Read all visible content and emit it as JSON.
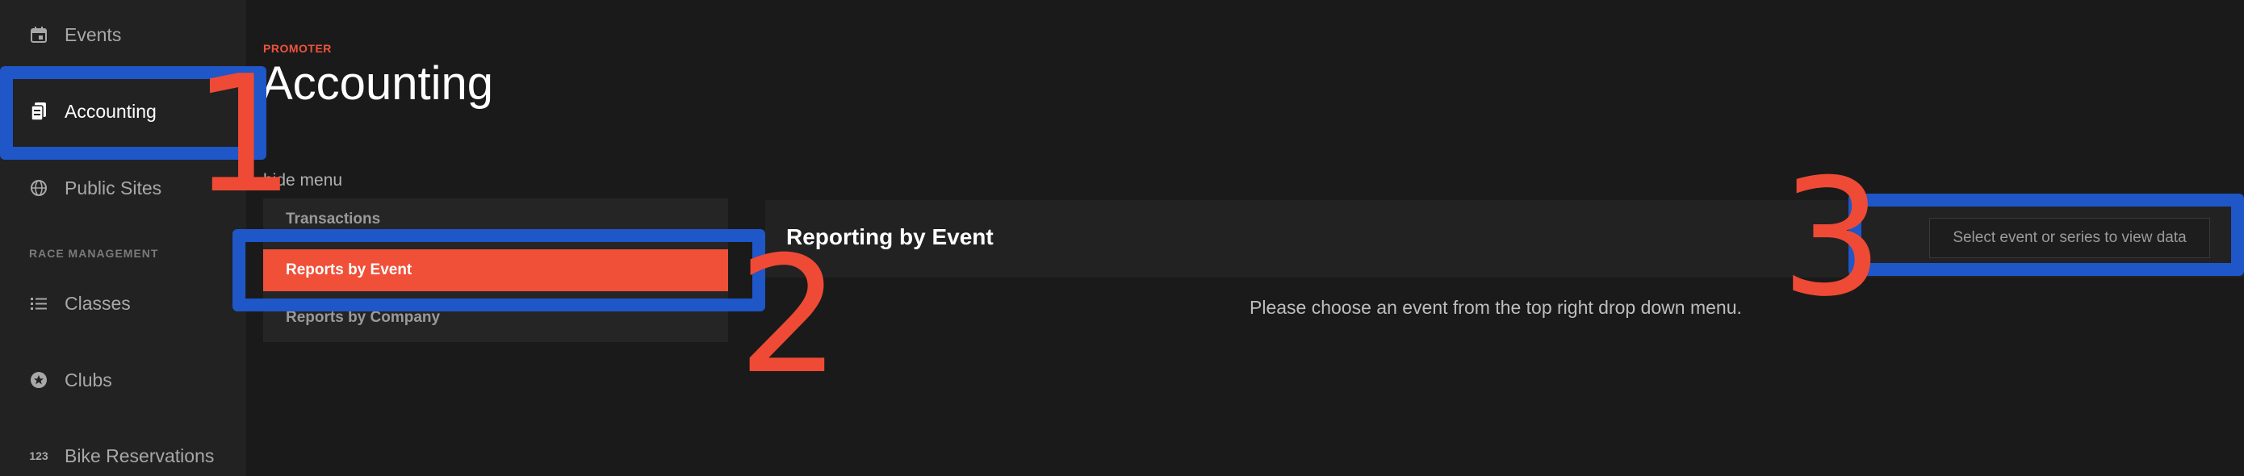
{
  "sidebar": {
    "items": [
      {
        "label": "Events",
        "icon": "calendar-icon"
      },
      {
        "label": "Accounting",
        "icon": "document-icon"
      },
      {
        "label": "Public Sites",
        "icon": "globe-icon"
      },
      {
        "label": "Classes",
        "icon": "list-icon"
      },
      {
        "label": "Clubs",
        "icon": "star-badge-icon"
      },
      {
        "label": "Bike Reservations",
        "icon": "number-icon",
        "glyph": "123"
      }
    ],
    "section_label": "RACE MANAGEMENT",
    "active": "Accounting"
  },
  "header": {
    "eyebrow": "PROMOTER",
    "title": "Accounting"
  },
  "menu": {
    "toggle_label": "hide menu",
    "items": [
      {
        "label": "Transactions"
      },
      {
        "label": "Reports by Event",
        "active": true
      },
      {
        "label": "Reports by Company"
      }
    ]
  },
  "report": {
    "title": "Reporting by Event",
    "select_placeholder": "Select event or series to view data",
    "empty_message": "Please choose an event from the top right drop down menu."
  },
  "annotations": {
    "numbers": [
      "1",
      "2",
      "3"
    ],
    "box_color": "#1f56c8",
    "number_color": "#ef4a35"
  },
  "colors": {
    "accent": "#f04f38",
    "background": "#1a1a1a",
    "sidebar": "#222222"
  }
}
